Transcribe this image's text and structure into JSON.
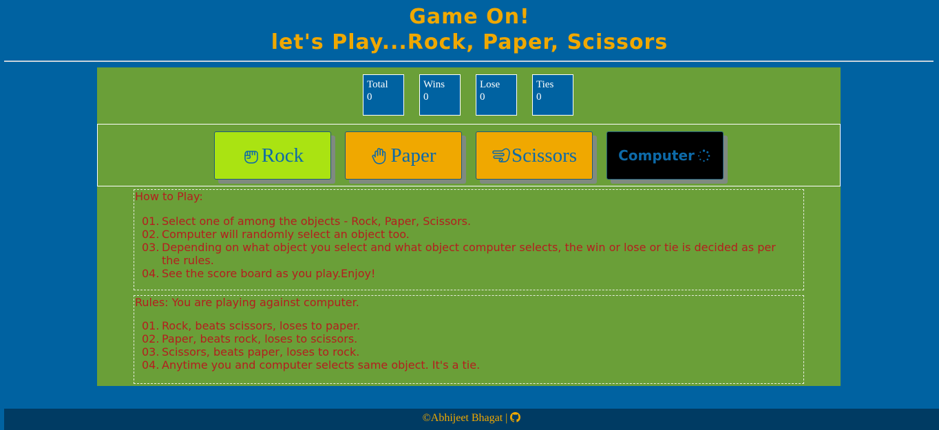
{
  "header": {
    "title_line1": "Game On!",
    "title_line2": "let's Play...Rock, Paper, Scissors"
  },
  "scoreboard": [
    {
      "label": "Total",
      "value": "0"
    },
    {
      "label": "Wins",
      "value": "0"
    },
    {
      "label": "Lose",
      "value": "0"
    },
    {
      "label": "Ties",
      "value": "0"
    }
  ],
  "choices": {
    "rock": {
      "label": "Rock",
      "color": "#aae312",
      "icon": "fist-icon"
    },
    "paper": {
      "label": "Paper",
      "color": "#f0a800",
      "icon": "open-hand-icon"
    },
    "scissors": {
      "label": "Scissors",
      "color": "#f0a800",
      "icon": "scissors-hand-icon"
    },
    "computer": {
      "label": "Computer",
      "color": "#000000",
      "icon": "spinner-icon"
    }
  },
  "how_to_play": {
    "heading": "How to Play:",
    "items": [
      {
        "num": "01.",
        "text": "Select one of among the objects - Rock, Paper, Scissors."
      },
      {
        "num": "02.",
        "text": "Computer will randomly select an object too."
      },
      {
        "num": "03.",
        "text": "Depending on what object you select and what object computer selects, the win or lose or tie is decided as per the rules."
      },
      {
        "num": "04.",
        "text": "See the score board as you play.Enjoy!"
      }
    ]
  },
  "rules": {
    "heading": "Rules: You are playing against computer.",
    "items": [
      {
        "num": "01.",
        "text": "Rock, beats scissors, loses to paper."
      },
      {
        "num": "02.",
        "text": "Paper, beats rock, loses to scissors."
      },
      {
        "num": "03.",
        "text": "Scissors, beats paper, loses to rock."
      },
      {
        "num": "04.",
        "text": "Anytime you and computer selects same object. It's a tie."
      }
    ]
  },
  "footer": {
    "credit": "©Abhijeet Bhagat |",
    "icon": "github-icon"
  },
  "colors": {
    "page_bg": "#0062a1",
    "game_bg": "#6a9f38",
    "title": "#f0a800",
    "instructions_text": "#b41e1e",
    "footer_bg": "#003b63"
  }
}
